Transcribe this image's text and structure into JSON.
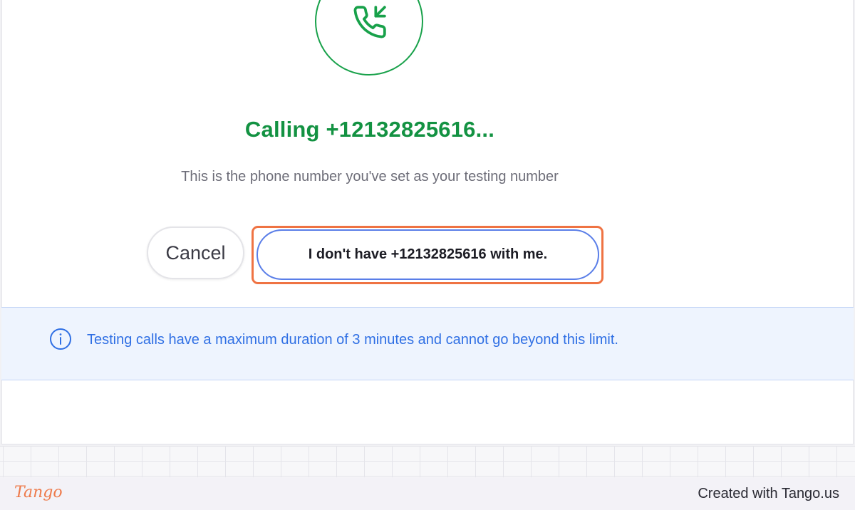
{
  "dialog": {
    "title": "Calling +12132825616...",
    "subtitle": "This is the phone number you've set as your testing number",
    "icon": "phone-incoming-icon",
    "accent_color": "#139242"
  },
  "actions": {
    "cancel_label": "Cancel",
    "no_phone_label": "I don't have +12132825616 with me."
  },
  "info_banner": {
    "icon": "info-icon",
    "text": "Testing calls have a maximum duration of 3 minutes and cannot go beyond this limit.",
    "color": "#2f6fe4"
  },
  "footer": {
    "logo_text": "Tango",
    "credit": "Created with Tango.us",
    "highlight_color": "#ef7343"
  }
}
